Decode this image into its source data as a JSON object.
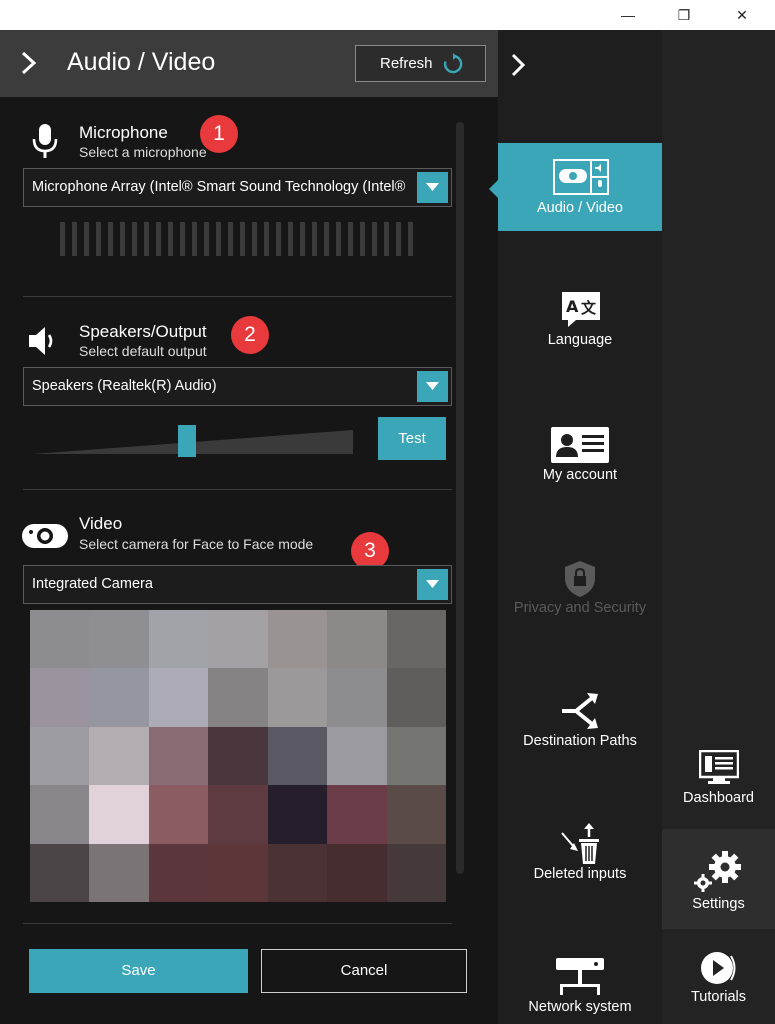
{
  "window": {
    "minimize_glyph": "—",
    "restore_glyph": "❐",
    "close_glyph": "✕"
  },
  "header": {
    "title": "Audio / Video",
    "refresh_label": "Refresh"
  },
  "microphone": {
    "title": "Microphone",
    "subtitle": "Select a microphone",
    "badge": "1",
    "selected": "Microphone Array (Intel® Smart Sound Technology (Intel®"
  },
  "speakers": {
    "title": "Speakers/Output",
    "subtitle": "Select default output",
    "badge": "2",
    "selected": "Speakers (Realtek(R) Audio)",
    "volume_level": 0.48,
    "test_label": "Test"
  },
  "video": {
    "title": "Video",
    "subtitle": "Select camera for Face to Face mode",
    "badge": "3",
    "selected": "Integrated Camera",
    "preview_colors": [
      "#8d8c90",
      "#8f8f93",
      "#a2a3a8",
      "#a3a1a4",
      "#9a9394",
      "#8b8a89",
      "#686766",
      "#9a929c",
      "#9696a0",
      "#adabb5",
      "#858384",
      "#9b999a",
      "#8d8c8e",
      "#5f5e5d",
      "#9d9ca3",
      "#b3adb2",
      "#8a6c74",
      "#4a373d",
      "#5a5863",
      "#9a9aa0",
      "#757672",
      "#88868a",
      "#e0d2d8",
      "#8c5c63",
      "#5e3b40",
      "#261f2b",
      "#6a3c48",
      "#5b4b48",
      "#4a4447",
      "#7b7476",
      "#5b363d",
      "#5c3638",
      "#4a3235",
      "#462d30",
      "#45393a"
    ]
  },
  "footer": {
    "save_label": "Save",
    "cancel_label": "Cancel"
  },
  "nav": {
    "items": [
      {
        "label": "Audio / Video",
        "state": "active"
      },
      {
        "label": "Language",
        "state": "normal"
      },
      {
        "label": "My account",
        "state": "normal"
      },
      {
        "label": "Privacy and Security",
        "state": "disabled"
      },
      {
        "label": "Destination Paths",
        "state": "normal"
      },
      {
        "label": "Deleted inputs",
        "state": "normal"
      },
      {
        "label": "Network system",
        "state": "normal"
      }
    ]
  },
  "strip": {
    "items": [
      {
        "label": "Dashboard",
        "state": "normal"
      },
      {
        "label": "Settings",
        "state": "active"
      },
      {
        "label": "Tutorials",
        "state": "normal"
      }
    ]
  },
  "colors": {
    "accent": "#3aa6b8",
    "badge": "#e8393c",
    "panel_bg": "#161616",
    "header_bg": "#3c3c3c"
  }
}
